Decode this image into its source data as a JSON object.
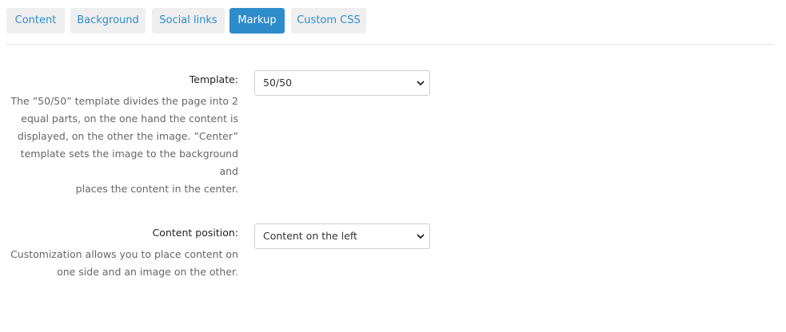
{
  "tabs": [
    {
      "label": "Content",
      "active": false
    },
    {
      "label": "Background",
      "active": false
    },
    {
      "label": "Social links",
      "active": false
    },
    {
      "label": "Markup",
      "active": true
    },
    {
      "label": "Custom CSS",
      "active": false
    }
  ],
  "fields": {
    "template": {
      "label": "Template:",
      "help_lines": [
        "The ”50/50” template divides the page into 2",
        "equal parts, on the one hand the content is",
        "displayed, on the other the image. ”Center”",
        "template sets the image to the background and",
        "places the content in the center."
      ],
      "selected": "50/50"
    },
    "content_position": {
      "label": "Content position:",
      "help_lines": [
        "Customization allows you to place content on",
        "one side and an image on the other."
      ],
      "selected": "Content on the left"
    }
  },
  "colors": {
    "accent": "#2f8ccb",
    "tab_bg": "#efefef",
    "help_text": "#666666"
  },
  "icons": {
    "select_arrow": "chevron-down-icon"
  }
}
